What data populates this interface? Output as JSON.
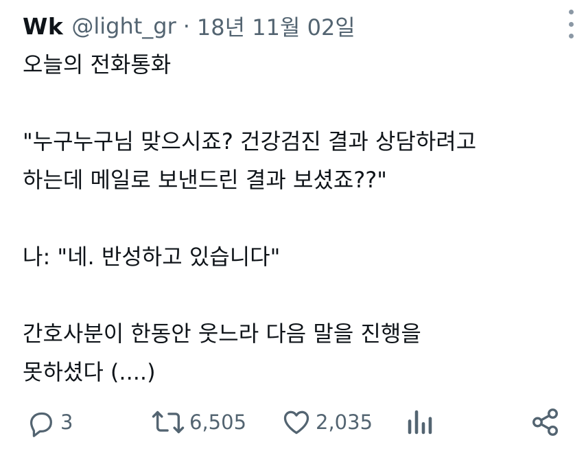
{
  "tweet": {
    "display_name": "Wk",
    "handle": "@light_gr",
    "separator": "·",
    "date": "18년 11월 02일",
    "lines": [
      "오늘의 전화통화",
      "",
      "\"누구누구님 맞으시죠? 건강검진 결과 상담하려고",
      "하는데 메일로 보낸드린 결과 보셨죠??\"",
      "",
      "나: \"네. 반성하고 있습니다\"",
      "",
      "간호사분이 한동안 웃느라 다음 말을 진행을",
      "못하셨다 (....)"
    ]
  },
  "actions": {
    "reply_count": "3",
    "retweet_count": "6,505",
    "like_count": "2,035"
  },
  "icons": {
    "more": "more-vertical-icon",
    "reply": "reply-icon",
    "retweet": "retweet-icon",
    "like": "heart-icon",
    "views": "views-icon",
    "share": "share-icon"
  },
  "colors": {
    "text": "#0f1419",
    "secondary": "#536471"
  }
}
